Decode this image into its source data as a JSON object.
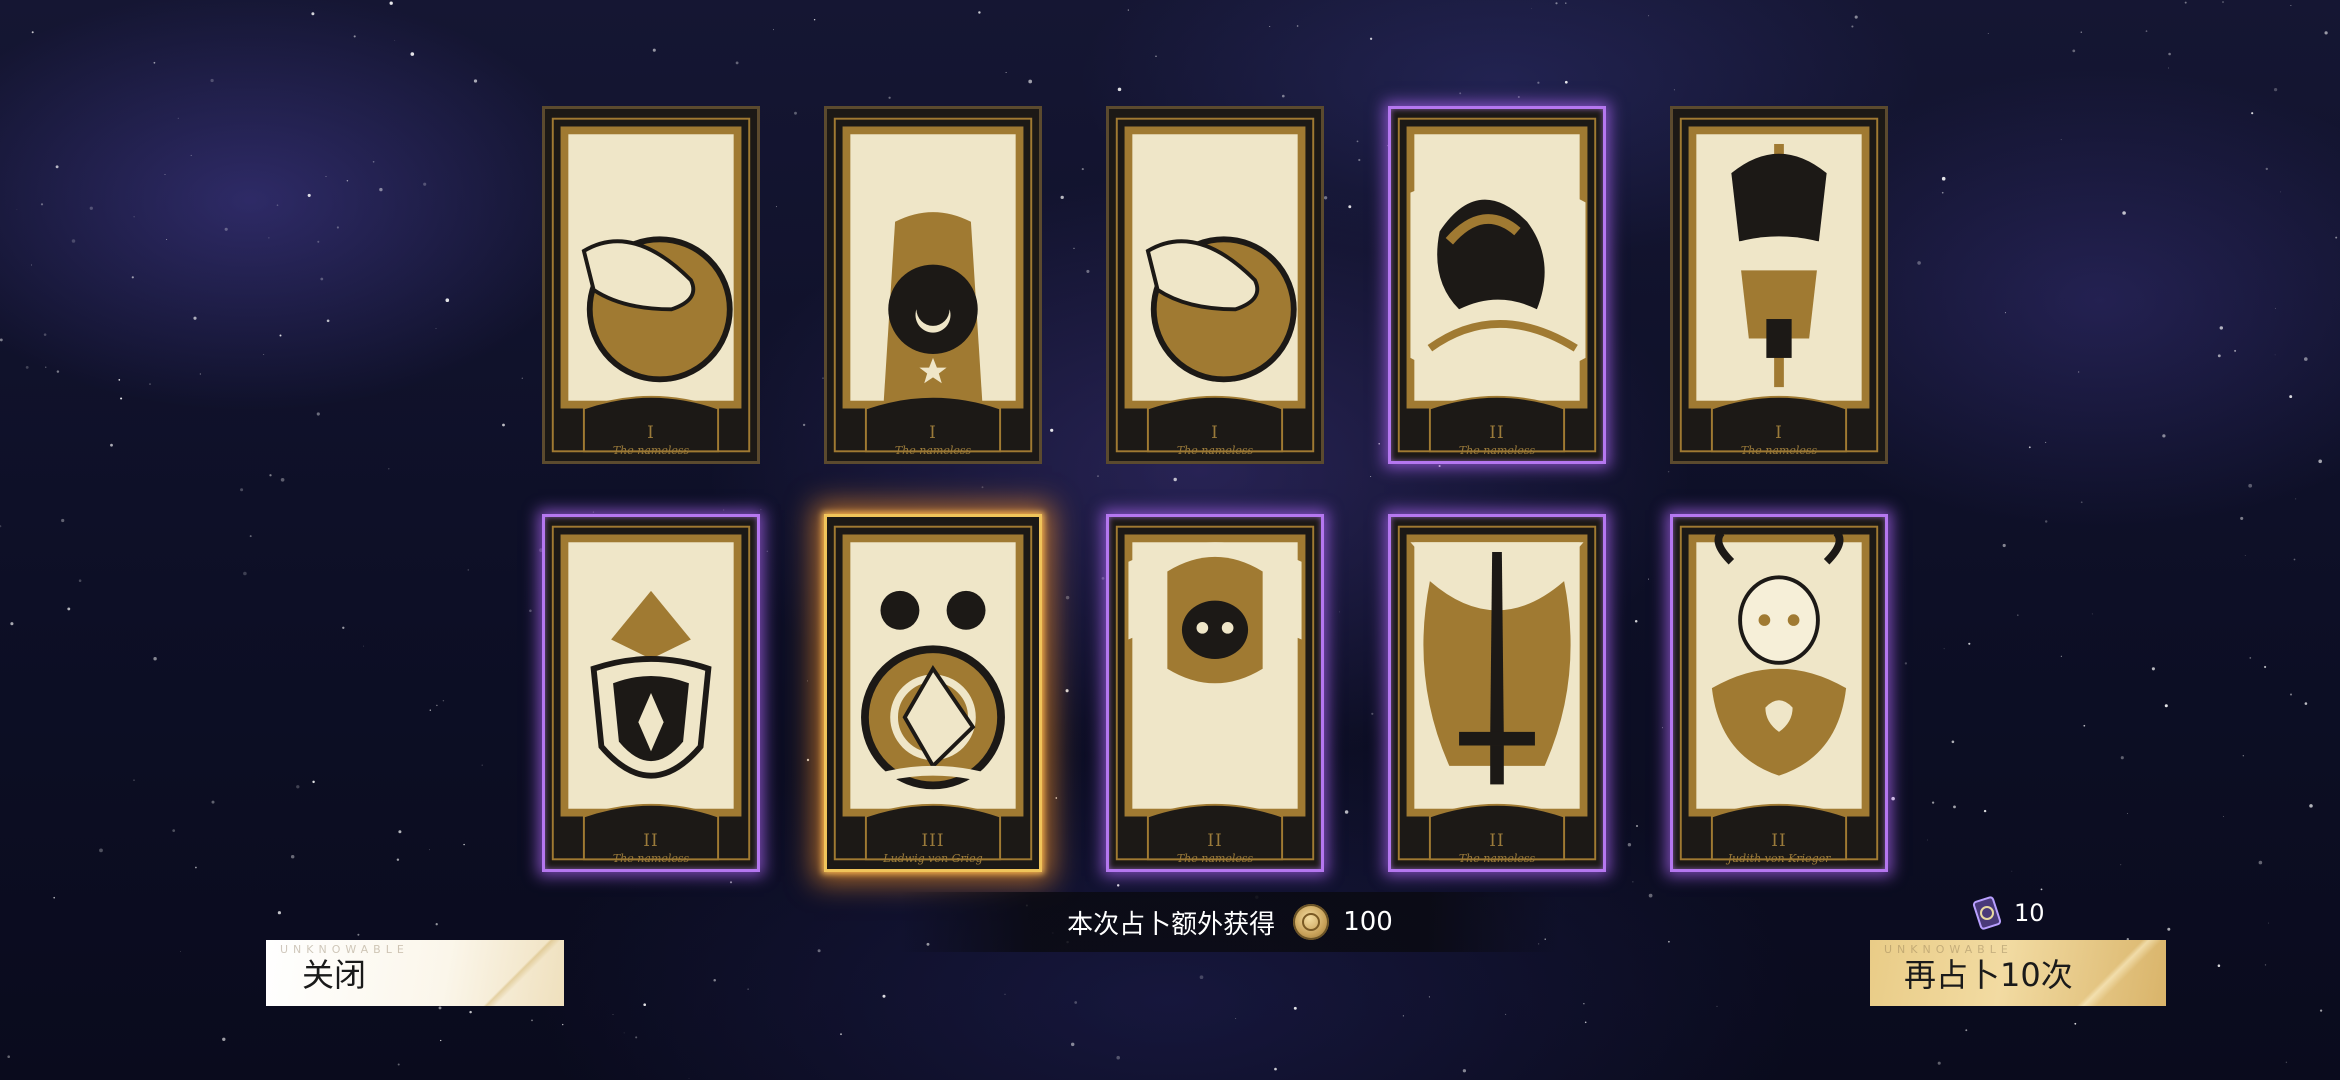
{
  "cards": [
    {
      "numeral": "I",
      "name": "The nameless",
      "rarity": "common",
      "motif": "hand"
    },
    {
      "numeral": "I",
      "name": "The nameless",
      "rarity": "common",
      "motif": "moon-figure"
    },
    {
      "numeral": "I",
      "name": "The nameless",
      "rarity": "common",
      "motif": "hand"
    },
    {
      "numeral": "II",
      "name": "The nameless",
      "rarity": "rare",
      "motif": "bird"
    },
    {
      "numeral": "I",
      "name": "The nameless",
      "rarity": "common",
      "motif": "sword-armor"
    },
    {
      "numeral": "II",
      "name": "The nameless",
      "rarity": "rare",
      "motif": "shield"
    },
    {
      "numeral": "III",
      "name": "Ludwig von Grieg",
      "rarity": "legendary",
      "motif": "skull"
    },
    {
      "numeral": "II",
      "name": "The nameless",
      "rarity": "rare",
      "motif": "hooded"
    },
    {
      "numeral": "II",
      "name": "The nameless",
      "rarity": "rare",
      "motif": "sword"
    },
    {
      "numeral": "II",
      "name": "Judith von Krieger",
      "rarity": "rare",
      "motif": "girl"
    }
  ],
  "bonus": {
    "label": "本次占卜额外获得",
    "icon": "coin-icon",
    "amount": "100"
  },
  "close_button": {
    "label": "关闭",
    "watermark": "UNKNOWABLE"
  },
  "again_button": {
    "label": "再占卜10次",
    "watermark": "UNKNOWABLE",
    "cost_icon": "ticket-icon",
    "cost": "10"
  },
  "colors": {
    "common_border": "#5b4a2e",
    "rare_glow": "#b577f0",
    "legendary_glow": "#f0c45a",
    "card_gold": "#a07a32",
    "card_cream": "#efe6c8"
  }
}
